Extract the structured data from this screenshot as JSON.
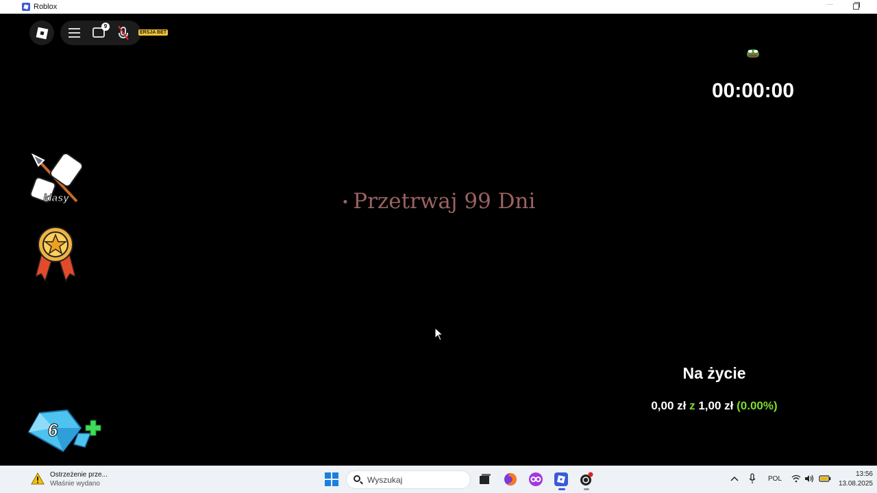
{
  "window": {
    "title": "Roblox"
  },
  "topbar": {
    "chat_badge_count": "9",
    "badge_text": "ERSJA BET"
  },
  "hud": {
    "timer": "00:00:00",
    "objective_bullet": "•",
    "objective": "Przetrwaj 99 Dni"
  },
  "left_menu": {
    "classes_label": "klasy",
    "gems_count": "6",
    "gems_plus": "+"
  },
  "life": {
    "title": "Na życie",
    "current": "0,00 zł",
    "separator": "z",
    "target": "1,00 zł",
    "percent": "(0.00%)",
    "progress_fraction": 0.0
  },
  "taskbar": {
    "notification_title": "Ostrzeżenie prze...",
    "notification_sub": "Właśnie wydano",
    "search_placeholder": "Wyszukaj",
    "language": "POL",
    "time": "13:56",
    "date": "13.08.2025"
  },
  "colors": {
    "objective": "#9b6262",
    "life_green": "#7ddb2e",
    "taskbar_bg": "#eef1f5"
  }
}
